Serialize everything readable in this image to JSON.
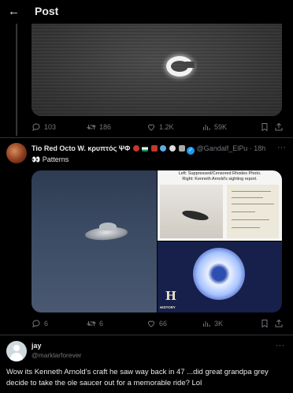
{
  "header": {
    "back_icon": "←",
    "title": "Post"
  },
  "post1": {
    "actions": {
      "replies": "103",
      "retweets": "186",
      "likes": "1.2K",
      "views": "59K"
    }
  },
  "post2": {
    "author_name": "Tio Red Octo W. κρυπτός ΨΦ",
    "verified_mark": "✓",
    "handle": "@Gandalf_ElPu",
    "time": "· 18h",
    "more": "···",
    "text": "👀 Patterns",
    "media_caption": "Left: Suppressed/Censored Rhodes Photo.\nRight: Kenneth Arnold's sighting report.",
    "media_logo_letter": "H",
    "media_logo_text": "HISTORY",
    "actions": {
      "replies": "6",
      "retweets": "6",
      "likes": "66",
      "views": "3K"
    }
  },
  "post3": {
    "author_name": "jay",
    "handle": "@marklarforever",
    "more": "···",
    "text": "Wow its Kenneth Arnold's craft he saw way back in 47 ...did great grandpa grey decide to take the ole saucer out for a memorable ride? Lol"
  },
  "colors": {
    "background": "#000000",
    "text": "#e7e9ea",
    "muted": "#71767b",
    "divider": "#2f3336",
    "verified": "#1d9bf0"
  }
}
